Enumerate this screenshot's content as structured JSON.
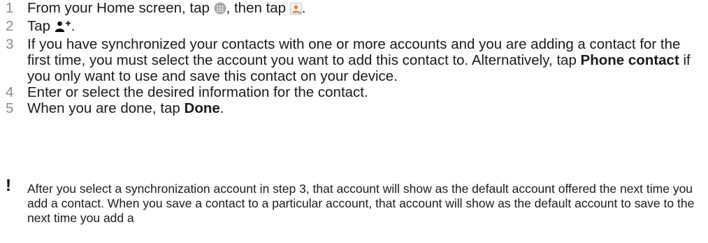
{
  "steps": [
    {
      "num": "1",
      "t1": "From your Home screen, tap ",
      "t2": ", then tap ",
      "t3": "."
    },
    {
      "num": "2",
      "t1": "Tap ",
      "t2": "."
    },
    {
      "num": "3",
      "t1": "If you have synchronized your contacts with one or more accounts and you are adding a contact for the first time, you must select the account you want to add this contact to. Alternatively, tap ",
      "bold": "Phone contact",
      "t2": " if you only want to use and save this contact on your device."
    },
    {
      "num": "4",
      "t1": "Enter or select the desired information for the contact."
    },
    {
      "num": "5",
      "t1": "When you are done, tap ",
      "bold": "Done",
      "t2": "."
    }
  ],
  "note": {
    "mark": "!",
    "text": "After you select a synchronization account in step 3, that account will show as the default account offered the next time you add a contact. When you save a contact to a particular account, that account will show as the default account to save to the next time you add a"
  },
  "icons": [
    "apps-grid-icon",
    "contacts-app-icon",
    "add-contact-icon"
  ],
  "colors": {
    "number": "#8c8c8c",
    "text": "#1a1a1a",
    "contacts_icon": "#e0833a"
  }
}
